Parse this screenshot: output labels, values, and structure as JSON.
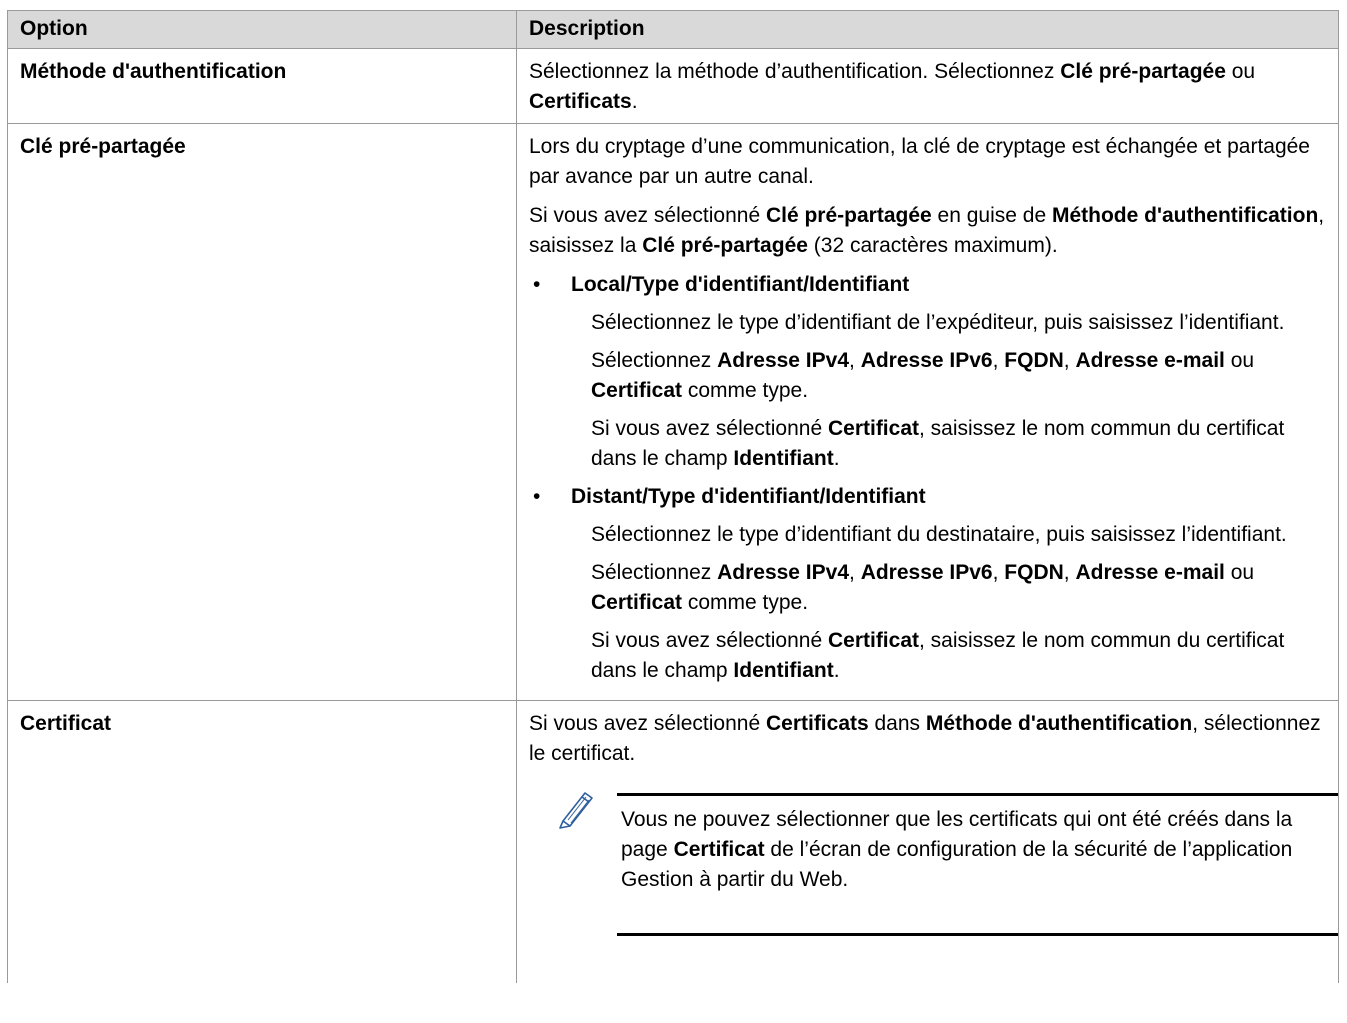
{
  "header": {
    "option": "Option",
    "description": "Description"
  },
  "rows": [
    {
      "option": "Méthode d'authentification",
      "desc": {
        "t1": "Sélectionnez la méthode d’authentification. Sélectionnez ",
        "b1": "Clé pré-partagée",
        "t2": " ou ",
        "b2": "Certificats",
        "t3": "."
      }
    },
    {
      "option": "Clé pré-partagée",
      "para1": "Lors du cryptage d’une communication, la clé de cryptage est échangée et partagée par avance par un autre canal.",
      "para2": {
        "t1": "Si vous avez sélectionné ",
        "b1": "Clé pré-partagée",
        "t2": " en guise de ",
        "b2": "Méthode d'authentification",
        "t3": ", saisissez la ",
        "b3": "Clé pré-partagée",
        "t4": " (32 caractères maximum)."
      },
      "bullet_symbol": "•",
      "bullets": [
        {
          "title": "Local/Type d'identifiant/Identifiant",
          "p1": "Sélectionnez le type d’identifiant de l’expéditeur, puis saisissez l’identifiant.",
          "p2": {
            "t1": "Sélectionnez ",
            "b1": "Adresse IPv4",
            "t2": ", ",
            "b2": "Adresse IPv6",
            "t3": ", ",
            "b3": "FQDN",
            "t4": ", ",
            "b4": "Adresse e-mail",
            "t5": " ou ",
            "b5": "Certificat",
            "t6": " comme type."
          },
          "p3": {
            "t1": "Si vous avez sélectionné ",
            "b1": "Certificat",
            "t2": ", saisissez le nom commun du certificat dans le champ ",
            "b2": "Identifiant",
            "t3": "."
          }
        },
        {
          "title": "Distant/Type d'identifiant/Identifiant",
          "p1": "Sélectionnez le type d’identifiant du destinataire, puis saisissez l’identifiant.",
          "p2": {
            "t1": "Sélectionnez ",
            "b1": "Adresse IPv4",
            "t2": ", ",
            "b2": "Adresse IPv6",
            "t3": ", ",
            "b3": "FQDN",
            "t4": ", ",
            "b4": "Adresse e-mail",
            "t5": " ou ",
            "b5": "Certificat",
            "t6": " comme type."
          },
          "p3": {
            "t1": "Si vous avez sélectionné ",
            "b1": "Certificat",
            "t2": ", saisissez le nom commun du certificat dans le champ ",
            "b2": "Identifiant",
            "t3": "."
          }
        }
      ]
    },
    {
      "option": "Certificat",
      "para1": {
        "t1": "Si vous avez sélectionné ",
        "b1": "Certificats",
        "t2": " dans ",
        "b2": "Méthode d'authentification",
        "t3": ", sélectionnez le certificat."
      },
      "note": {
        "icon": "pencil-note-icon",
        "t1": "Vous ne pouvez sélectionner que les certificats qui ont été créés dans la page ",
        "b1": "Certificat",
        "t2": " de l’écran de configuration de la sécurité de l’application Gestion à partir du Web."
      }
    }
  ],
  "colors": {
    "header_bg": "#d9d9d9",
    "border": "#9a9a9a",
    "text": "#000000"
  }
}
